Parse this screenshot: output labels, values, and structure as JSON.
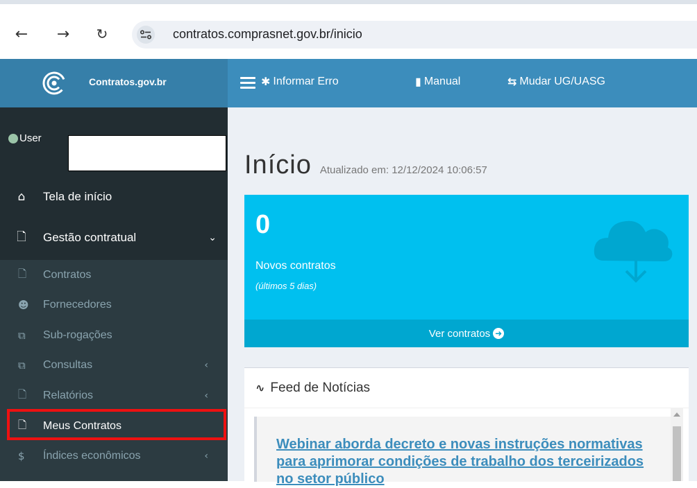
{
  "browser": {
    "back_icon": "arrow-left-icon",
    "forward_icon": "arrow-right-icon",
    "reload_icon": "reload-icon",
    "url": "contratos.comprasnet.gov.br/inicio"
  },
  "header": {
    "brand": "Contratos.gov.br",
    "links": [
      {
        "icon": "bug-icon",
        "label": "Informar Erro"
      },
      {
        "icon": "book-icon",
        "label": "Manual"
      },
      {
        "icon": "exchange-icon",
        "label": "Mudar UG/UASG"
      }
    ],
    "accent_color": "#3c8dbc"
  },
  "sidebar": {
    "user_label": "User",
    "items": [
      {
        "icon": "home-icon",
        "label": "Tela de início"
      },
      {
        "icon": "file-icon",
        "label": "Gestão contratual"
      }
    ],
    "subitems": [
      {
        "icon": "file-icon",
        "label": "Contratos"
      },
      {
        "icon": "users-icon",
        "label": "Fornecedores"
      },
      {
        "icon": "copy-icon",
        "label": "Sub-rogações"
      },
      {
        "icon": "copy-icon",
        "label": "Consultas"
      },
      {
        "icon": "file-icon",
        "label": "Relatórios"
      },
      {
        "icon": "file-icon",
        "label": "Meus Contratos"
      },
      {
        "icon": "dollar-icon",
        "label": "Índices econômicos"
      }
    ],
    "highlight_color": "#ee1111"
  },
  "main": {
    "title": "Início",
    "updated": "Atualizado em: 12/12/2024 10:06:57",
    "box": {
      "number": "0",
      "label": "Novos contratos",
      "sublabel": "(últimos 5 dias)",
      "footer": "Ver contratos",
      "color": "#00c0ef"
    },
    "feed": {
      "title": "Feed de Notícias",
      "article": "Webinar aborda decreto e novas instruções normativas para aprimorar condições de trabalho dos terceirizados no setor público"
    }
  }
}
